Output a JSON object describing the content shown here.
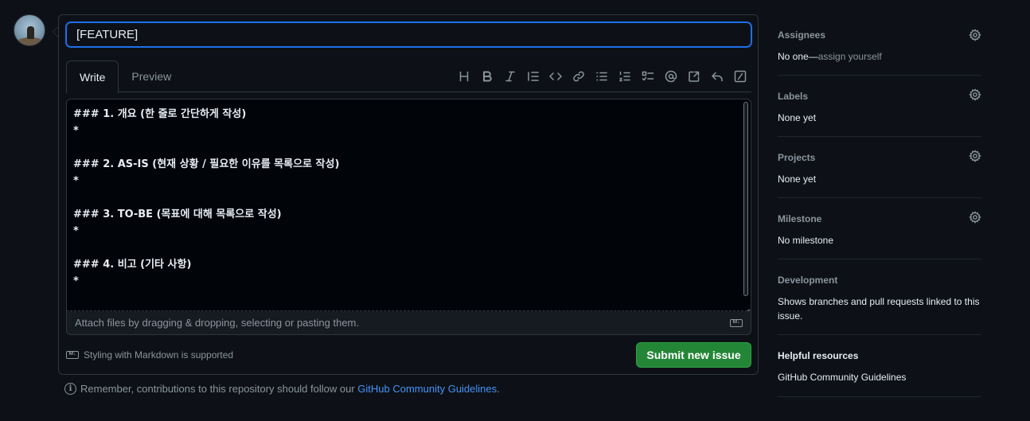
{
  "issue": {
    "title_value": "[FEATURE]",
    "tabs": [
      "Write",
      "Preview"
    ],
    "body_value": "### 1. 개요 (한 줄로 간단하게 작성)\n*\n\n### 2. AS-IS (현재 상황 / 필요한 이유를 목록으로 작성)\n*\n\n### 3. TO-BE (목표에 대해 목록으로 작성)\n*\n\n### 4. 비고 (기타 사항)\n*",
    "attach_hint": "Attach files by dragging & dropping, selecting or pasting them.",
    "markdown_note": "Styling with Markdown is supported",
    "submit_label": "Submit new issue",
    "remember_prefix": "Remember, contributions to this repository should follow our ",
    "remember_link": "GitHub Community Guidelines",
    "remember_suffix": "."
  },
  "toolbar": {
    "icons": [
      "heading-icon",
      "bold-icon",
      "italic-icon",
      "quote-icon",
      "code-icon",
      "link-icon",
      "unordered-list-icon",
      "ordered-list-icon",
      "task-list-icon",
      "mention-icon",
      "cross-reference-icon",
      "reply-icon",
      "slash-command-icon"
    ]
  },
  "sidebar": {
    "assignees": {
      "label": "Assignees",
      "value": "No one—",
      "action": "assign yourself"
    },
    "labels": {
      "label": "Labels",
      "value": "None yet"
    },
    "projects": {
      "label": "Projects",
      "value": "None yet"
    },
    "milestone": {
      "label": "Milestone",
      "value": "No milestone"
    },
    "development": {
      "label": "Development",
      "value": "Shows branches and pull requests linked to this issue."
    },
    "helpful": {
      "label": "Helpful resources",
      "link": "GitHub Community Guidelines"
    }
  },
  "colors": {
    "accent": "#1f6feb",
    "submit": "#238636",
    "link": "#4493f8",
    "background": "#0d1117"
  }
}
